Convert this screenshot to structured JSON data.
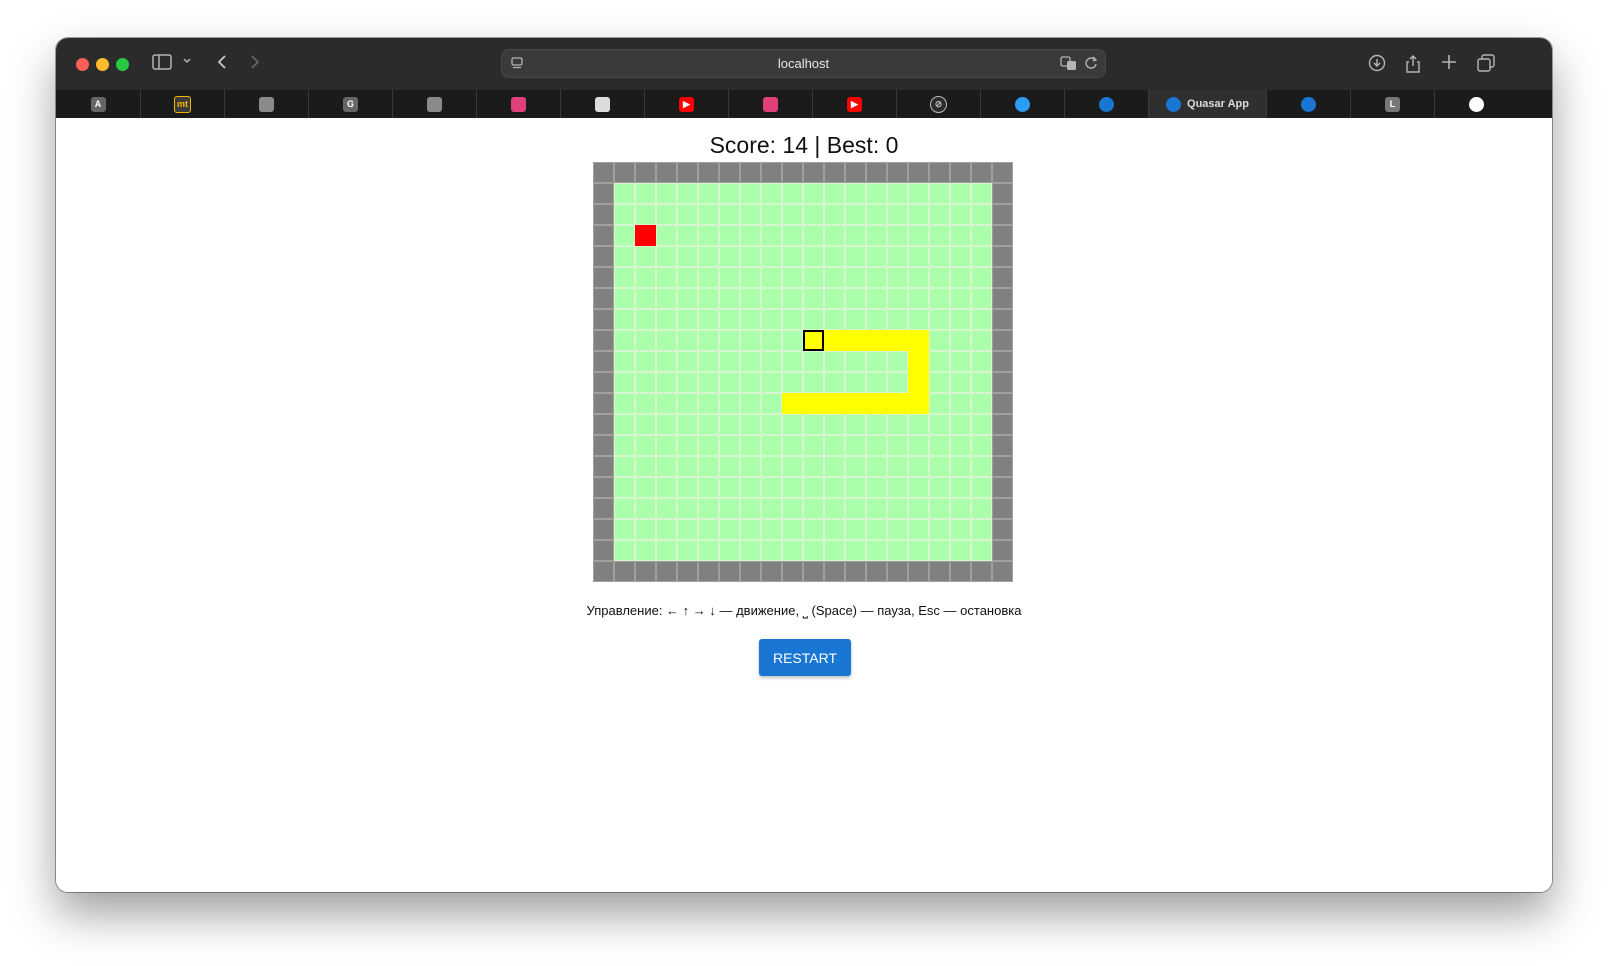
{
  "browser": {
    "url": "localhost",
    "tabs": [
      {
        "icon": "letter-a-favicon",
        "label": "",
        "favicon_text": "A",
        "color": "#666666"
      },
      {
        "icon": "mt-favicon",
        "label": "",
        "favicon_text": "mt",
        "color": "#3a3a3a"
      },
      {
        "icon": "gray-gear-favicon",
        "label": "",
        "favicon_text": "",
        "color": "#8a8a8a"
      },
      {
        "icon": "letter-g-favicon",
        "label": "",
        "favicon_text": "G",
        "color": "#666666"
      },
      {
        "icon": "gray-gear-favicon",
        "label": "",
        "favicon_text": "",
        "color": "#8a8a8a"
      },
      {
        "icon": "bar-logo-favicon",
        "label": "",
        "favicon_text": "",
        "color": "#e0407a"
      },
      {
        "icon": "cisco-favicon",
        "label": "",
        "favicon_text": "",
        "color": "#dddddd"
      },
      {
        "icon": "youtube-favicon",
        "label": "",
        "favicon_text": "▶",
        "color": "#ff0000"
      },
      {
        "icon": "bar-logo-favicon",
        "label": "",
        "favicon_text": "",
        "color": "#e0407a"
      },
      {
        "icon": "youtube-favicon",
        "label": "",
        "favicon_text": "▶",
        "color": "#ff0000"
      },
      {
        "icon": "compass-favicon",
        "label": "",
        "favicon_text": "⊘",
        "color": "#2b2b2b"
      },
      {
        "icon": "circle-favicon",
        "label": "",
        "favicon_text": "",
        "color": "#2a9df4"
      },
      {
        "icon": "quasar-favicon",
        "label": "",
        "favicon_text": "",
        "color": "#1976d2"
      },
      {
        "icon": "quasar-favicon",
        "label": "Quasar App",
        "favicon_text": "",
        "color": "#1976d2",
        "active": true
      },
      {
        "icon": "quasar-favicon",
        "label": "",
        "favicon_text": "",
        "color": "#1976d2"
      },
      {
        "icon": "letter-l-favicon",
        "label": "",
        "favicon_text": "L",
        "color": "#777777"
      },
      {
        "icon": "github-favicon",
        "label": "",
        "favicon_text": "",
        "color": "#ffffff"
      }
    ]
  },
  "game": {
    "score_text": "Score: 14 | Best: 0",
    "score": 14,
    "best": 0,
    "grid_size": 20,
    "food": [
      2,
      3
    ],
    "snake_head": [
      10,
      8
    ],
    "snake_body": [
      [
        11,
        8
      ],
      [
        12,
        8
      ],
      [
        13,
        8
      ],
      [
        14,
        8
      ],
      [
        15,
        8
      ],
      [
        15,
        9
      ],
      [
        15,
        10
      ],
      [
        15,
        11
      ],
      [
        14,
        11
      ],
      [
        13,
        11
      ],
      [
        12,
        11
      ],
      [
        11,
        11
      ],
      [
        10,
        11
      ],
      [
        9,
        11
      ]
    ],
    "colors": {
      "field": "#aaffaa",
      "wall": "#808080",
      "food": "#ff0000",
      "snake": "#ffff00"
    },
    "controls_text": "Управление: ← ↑ → ↓ — движение, ⎵ (Space) — пауза, Esc — остановка",
    "restart_label": "RESTART"
  }
}
